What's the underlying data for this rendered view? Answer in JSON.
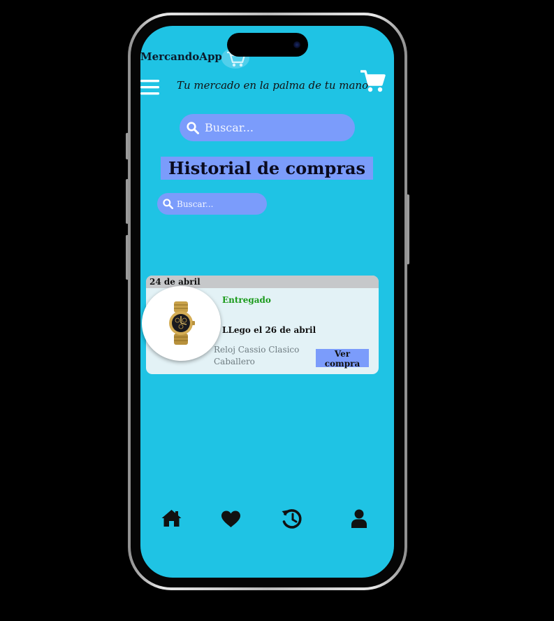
{
  "header": {
    "app_title": "MercandoApp",
    "tagline": "Tu mercado en la palma de tu mano",
    "logo_icon": "shopping-cart-logo",
    "menu_icon": "hamburger-menu-icon",
    "cart_icon": "shopping-cart-icon"
  },
  "search": {
    "placeholder": "Buscar..."
  },
  "page": {
    "title": "Historial de compras"
  },
  "history_search": {
    "placeholder": "Buscar..."
  },
  "orders": [
    {
      "date": "24 de abril",
      "status": "Entregado",
      "arrival": "LLego el 26 de abril",
      "product": "Reloj Cassio Clasico Caballero",
      "button_label": "Ver compra",
      "image_icon": "gold-watch-image"
    }
  ],
  "bottom_nav": [
    {
      "icon": "home-icon"
    },
    {
      "icon": "heart-icon"
    },
    {
      "icon": "history-icon"
    },
    {
      "icon": "user-icon"
    }
  ],
  "colors": {
    "screen_bg": "#1fc3e4",
    "accent": "#7b9cfb",
    "status_green": "#1a9a1a",
    "card_bg": "#e3f2f6"
  }
}
